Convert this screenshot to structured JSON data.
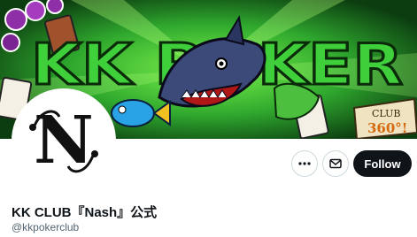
{
  "banner": {
    "brand_text": "KK POKER",
    "badge_line1": "CLUB",
    "badge_line2": "360°!"
  },
  "avatar": {
    "monogram": "N"
  },
  "actions": {
    "more_icon": "more-horizontal-icon",
    "message_icon": "envelope-icon",
    "follow_label": "Follow"
  },
  "profile": {
    "display_name": "KK CLUB『Nash』公式",
    "handle": "@kkpokerclub"
  },
  "colors": {
    "follow_bg": "#0f1419",
    "banner_green": "#2fa82e",
    "handle_gray": "#536471"
  }
}
